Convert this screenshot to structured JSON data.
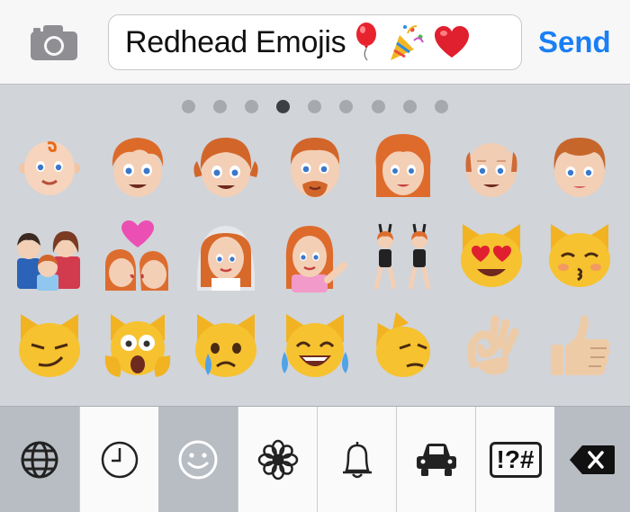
{
  "compose": {
    "message_text": "Redhead Emojis",
    "message_emojis": [
      "balloon",
      "party-popper",
      "red-heart"
    ],
    "send_label": "Send",
    "camera_icon": "camera-icon"
  },
  "keyboard": {
    "page_count": 9,
    "active_page": 4,
    "rows": [
      [
        "baby",
        "boy",
        "girl",
        "man",
        "woman",
        "older-man",
        "older-woman"
      ],
      [
        "family",
        "kiss",
        "bride-with-veil",
        "information-desk-person",
        "women-with-bunny-ears",
        "heart-eyes-cat",
        "kissing-cat"
      ],
      [
        "smirk-cat",
        "scream-cat",
        "crying-cat",
        "joy-cat",
        "pouting-cat",
        "ok-hand",
        "thumbs-up"
      ]
    ]
  },
  "categories": [
    {
      "name": "globe-icon",
      "style": "dark"
    },
    {
      "name": "clock-icon",
      "style": "light"
    },
    {
      "name": "smiley-icon",
      "style": "dark"
    },
    {
      "name": "flower-icon",
      "style": "light"
    },
    {
      "name": "bell-icon",
      "style": "light"
    },
    {
      "name": "car-icon",
      "style": "light"
    },
    {
      "name": "symbols-icon",
      "style": "light",
      "label": "!?#"
    },
    {
      "name": "delete-icon",
      "style": "dark"
    }
  ],
  "colors": {
    "send_blue": "#1a7ff4",
    "keyboard_bg": "#d1d4d9",
    "category_dark": "#b8bcc3",
    "category_light": "#fafafa"
  }
}
